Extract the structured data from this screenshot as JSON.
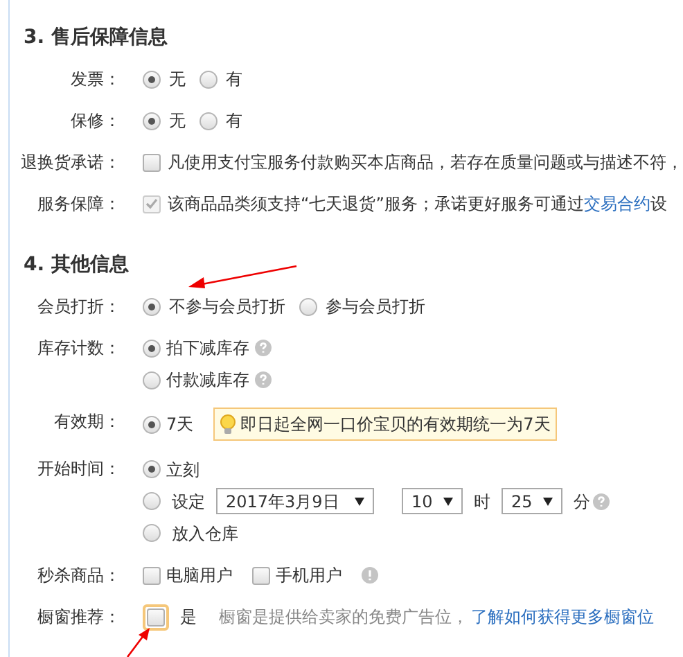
{
  "sections": [
    {
      "title": "3. 售后保障信息",
      "fields": [
        {
          "label": "发票：",
          "kind": "radio",
          "options": [
            {
              "text": "无",
              "selected": true
            },
            {
              "text": "有",
              "selected": false
            }
          ]
        },
        {
          "label": "保修：",
          "kind": "radio",
          "options": [
            {
              "text": "无",
              "selected": true
            },
            {
              "text": "有",
              "selected": false
            }
          ]
        },
        {
          "label": "退换货承诺：",
          "kind": "checkbox",
          "checked": false,
          "disabled": false,
          "text": "凡使用支付宝服务付款购买本店商品，若存在质量问题或与描述不符，"
        },
        {
          "label": "服务保障：",
          "kind": "checkbox",
          "checked": true,
          "disabled": true,
          "text": "该商品品类须支持“七天退货”服务；承诺更好服务可通过",
          "link": "交易合约",
          "text_after": "设"
        }
      ]
    },
    {
      "title": "4. 其他信息",
      "fields": [
        {
          "label": "会员打折：",
          "kind": "radio",
          "options": [
            {
              "text": "不参与会员打折",
              "selected": true
            },
            {
              "text": "参与会员打折",
              "selected": false
            }
          ]
        },
        {
          "label": "库存计数：",
          "kind": "radio_column",
          "options": [
            {
              "text": "拍下减库存",
              "selected": true,
              "help": true
            },
            {
              "text": "付款减库存",
              "selected": false,
              "help": true
            }
          ]
        },
        {
          "label": "有效期：",
          "kind": "radio_tip",
          "options": [
            {
              "text": "7天",
              "selected": true
            }
          ],
          "tip": "即日起全网一口价宝贝的有效期统一为7天"
        },
        {
          "label": "开始时间：",
          "kind": "start_time",
          "options": [
            {
              "kind": "plain",
              "text": "立刻",
              "selected": true
            },
            {
              "kind": "schedule",
              "text": "设定",
              "selected": false,
              "date": "2017年3月9日",
              "hour": "10",
              "hour_unit": "时",
              "minute": "25",
              "minute_unit": "分"
            },
            {
              "kind": "plain",
              "text": "放入仓库",
              "selected": false
            }
          ]
        },
        {
          "label": "秒杀商品：",
          "kind": "checkboxes",
          "options": [
            {
              "text": "电脑用户",
              "checked": false
            },
            {
              "text": "手机用户",
              "checked": false
            }
          ]
        },
        {
          "label": "橱窗推荐：",
          "kind": "showcase",
          "checked": false,
          "highlighted": true,
          "text": "是",
          "note": "橱窗是提供给卖家的免费广告位，",
          "link": "了解如何获得更多橱窗位"
        }
      ]
    }
  ]
}
